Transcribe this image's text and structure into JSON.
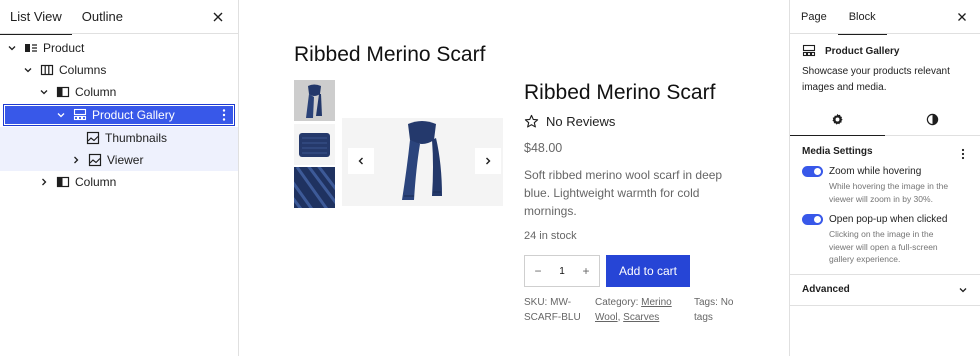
{
  "list_view": {
    "tabs": [
      {
        "label": "List View",
        "active": true
      },
      {
        "label": "Outline",
        "active": false
      }
    ],
    "tree": [
      {
        "label": "Product",
        "level": 0,
        "icon": "product-icon",
        "expanded": true
      },
      {
        "label": "Columns",
        "level": 1,
        "icon": "columns-icon",
        "expanded": true
      },
      {
        "label": "Column",
        "level": 2,
        "icon": "column-icon",
        "expanded": true
      },
      {
        "label": "Product Gallery",
        "level": 3,
        "icon": "gallery-icon",
        "expanded": true,
        "selected": true
      },
      {
        "label": "Thumbnails",
        "level": 4,
        "icon": "image-icon"
      },
      {
        "label": "Viewer",
        "level": 4,
        "icon": "image-icon",
        "expanded": false
      },
      {
        "label": "Column",
        "level": 2,
        "icon": "column-icon",
        "expanded": false
      }
    ]
  },
  "canvas": {
    "page_title": "Ribbed Merino Scarf",
    "product": {
      "title": "Ribbed Merino Scarf",
      "reviews": "No Reviews",
      "price": "$48.00",
      "description": "Soft ribbed merino wool scarf in deep blue. Lightweight warmth for cold mornings.",
      "stock": "24 in stock",
      "quantity": "1",
      "qty_minus": "−",
      "qty_plus": "+",
      "add_to_cart": "Add to cart",
      "sku_label": "SKU:",
      "sku_value_1": "MW-",
      "sku_value_2": "SCARF-BLU",
      "category_label": "Category:",
      "category_1": "Merino",
      "category_2": "Wool",
      "category_sep": ",",
      "category_3": "Scarves",
      "tags_label": "Tags:",
      "tags_value_1": "No",
      "tags_value_2": "tags"
    }
  },
  "inspector": {
    "tabs": [
      {
        "label": "Page",
        "active": false
      },
      {
        "label": "Block",
        "active": true
      }
    ],
    "block_name": "Product Gallery",
    "block_description": "Showcase your products relevant images and media.",
    "subtabs": [
      {
        "icon": "gear-icon",
        "active": true
      },
      {
        "icon": "contrast-icon",
        "active": false
      }
    ],
    "media_settings": {
      "title": "Media Settings",
      "options": [
        {
          "label": "Zoom while hovering",
          "enabled": true,
          "help": "While hovering the image in the viewer will zoom in by 30%."
        },
        {
          "label": "Open pop-up when clicked",
          "enabled": true,
          "help": "Clicking on the image in the viewer will open a full-screen gallery experience."
        }
      ]
    },
    "advanced_label": "Advanced"
  },
  "colors": {
    "accent": "#3858e9",
    "button": "#2645d6",
    "scarf": "#243a6b"
  }
}
